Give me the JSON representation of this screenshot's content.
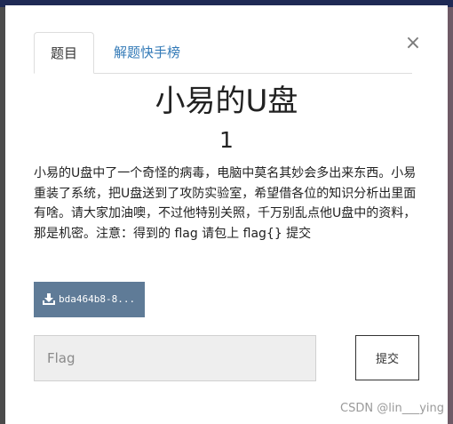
{
  "tabs": [
    {
      "label": "题目"
    },
    {
      "label": "解题快手榜"
    }
  ],
  "close_glyph": "×",
  "challenge": {
    "title": "小易的U盘",
    "points": "1",
    "description": "小易的U盘中了一个奇怪的病毒，电脑中莫名其妙会多出来东西。小易重装了系统，把U盘送到了攻防实验室，希望借各位的知识分析出里面有啥。请大家加油噢，不过他特别关照，千万别乱点他U盘中的资料，那是机密。注意：得到的 flag 请包上 flag{} 提交",
    "file_label": "bda464b8-8..."
  },
  "flag_input": {
    "placeholder": "Flag",
    "value": ""
  },
  "submit_label": "提交",
  "watermark": "CSDN @lin___ying",
  "colors": {
    "download_button": "#5f7b97",
    "tab_link": "#337ab7",
    "input_bg": "#eeeeee"
  },
  "icons": {
    "download": "download-icon",
    "close": "close-icon"
  }
}
